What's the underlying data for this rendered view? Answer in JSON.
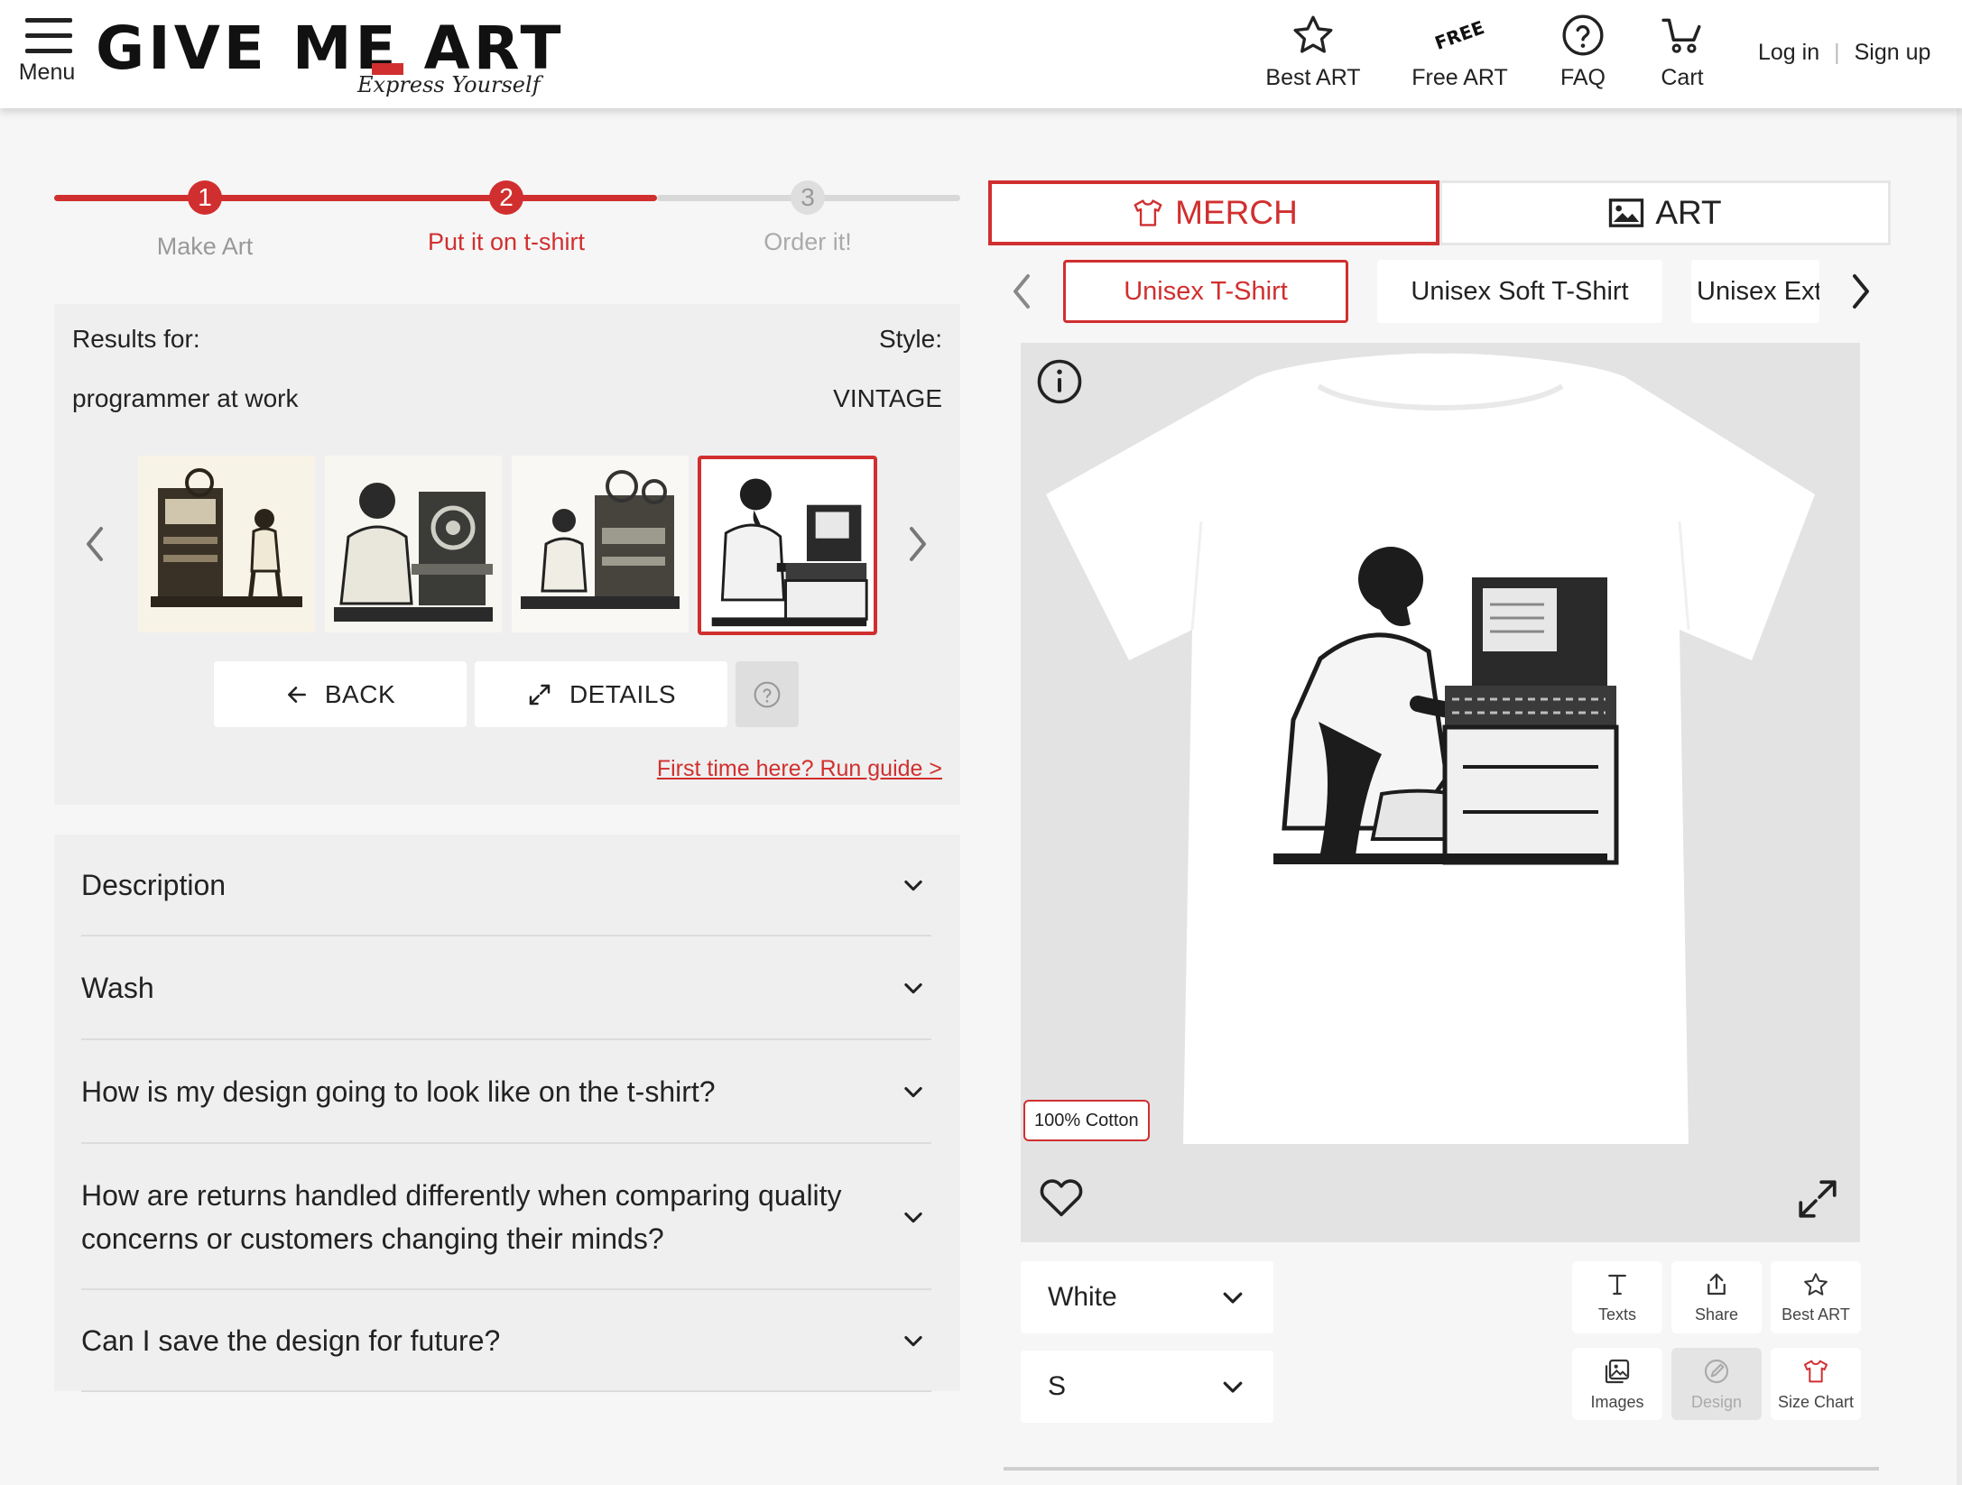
{
  "header": {
    "menu_label": "Menu",
    "logo_text": "GIVE ME ART",
    "logo_tagline": "Express Yourself",
    "nav": [
      {
        "icon": "star-icon",
        "label": "Best ART"
      },
      {
        "icon": "free-badge-icon",
        "badge": "FREE",
        "label": "Free ART"
      },
      {
        "icon": "question-circle-icon",
        "label": "FAQ"
      },
      {
        "icon": "cart-icon",
        "label": "Cart"
      }
    ],
    "login": "Log in",
    "signup": "Sign up"
  },
  "stepper": {
    "steps": [
      {
        "num": "1",
        "label": "Make Art"
      },
      {
        "num": "2",
        "label": "Put it on t-shirt"
      },
      {
        "num": "3",
        "label": "Order it!"
      }
    ],
    "current": 2
  },
  "results": {
    "results_for_label": "Results for:",
    "query": "programmer at work",
    "style_label": "Style:",
    "style_value": "VINTAGE",
    "thumbnails_count": 4,
    "selected_thumbnail": 4,
    "back_label": "BACK",
    "details_label": "DETAILS",
    "guide_link": "First time here? Run guide >"
  },
  "faq": [
    "Description",
    "Wash",
    "How is my design going to look like on the t-shirt?",
    "How are returns handled differently when comparing quality concerns or customers changing their minds?",
    "Can I save the design for future?"
  ],
  "tabs": {
    "merch_label": "MERCH",
    "art_label": "ART",
    "active": "MERCH"
  },
  "products": {
    "items": [
      "Unisex T-Shirt",
      "Unisex Soft T-Shirt",
      "Unisex Ext"
    ],
    "selected": "Unisex T-Shirt"
  },
  "preview": {
    "material_badge": "100% Cotton"
  },
  "options": {
    "color_value": "White",
    "size_value": "S"
  },
  "tools": [
    {
      "icon": "text-icon",
      "label": "Texts"
    },
    {
      "icon": "share-icon",
      "label": "Share"
    },
    {
      "icon": "star-icon",
      "label": "Best ART"
    },
    {
      "icon": "images-icon",
      "label": "Images"
    },
    {
      "icon": "design-pen-icon",
      "label": "Design"
    },
    {
      "icon": "tshirt-icon",
      "label": "Size Chart"
    }
  ],
  "colors": {
    "accent": "#d12f2f",
    "inactive_step": "#c8c8c8",
    "panel_bg": "#efefef",
    "preview_bg": "#e3e3e3"
  }
}
